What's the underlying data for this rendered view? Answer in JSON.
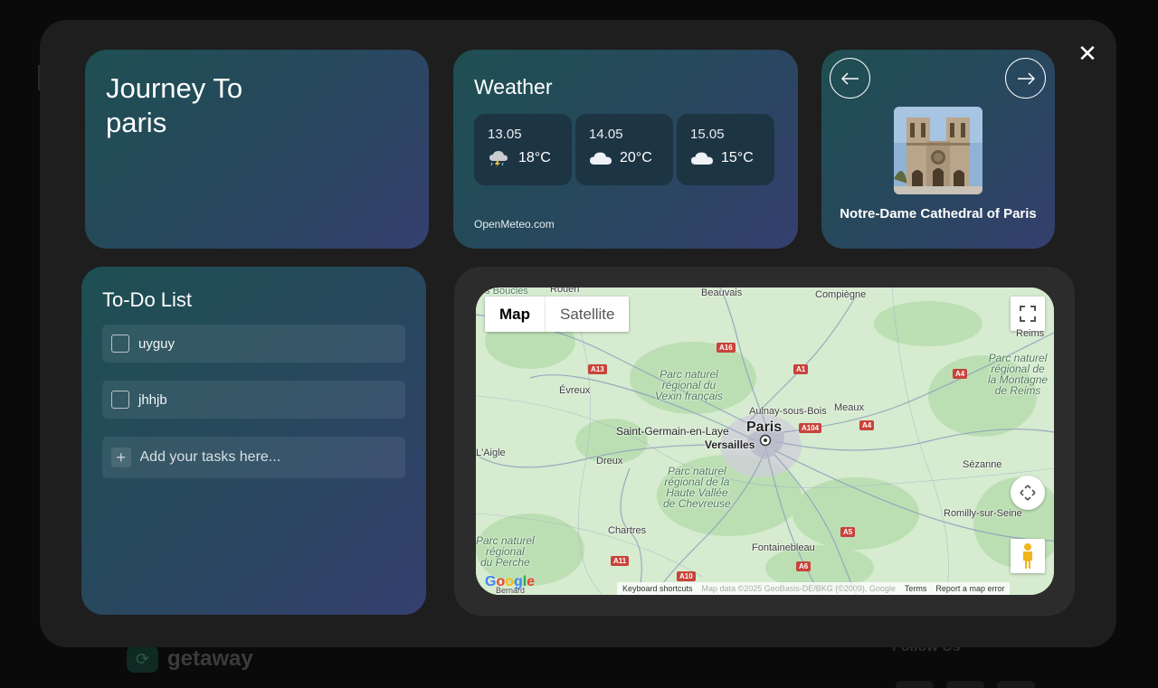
{
  "background": {
    "brand": "getaway",
    "follow_label": "Follow Us"
  },
  "trip": {
    "title_line1": "Journey To",
    "title_line2": "paris"
  },
  "weather": {
    "title": "Weather",
    "source": "OpenMeteo.com",
    "days": [
      {
        "date": "13.05",
        "temp": "18°C",
        "icon": "thunderstorm-icon"
      },
      {
        "date": "14.05",
        "temp": "20°C",
        "icon": "cloud-icon"
      },
      {
        "date": "15.05",
        "temp": "15°C",
        "icon": "cloud-icon"
      }
    ]
  },
  "place": {
    "name": "Notre-Dame Cathedral of Paris"
  },
  "todo": {
    "title": "To-Do List",
    "tasks": [
      {
        "label": "uyguy"
      },
      {
        "label": "jhhjb"
      }
    ],
    "add_placeholder": "Add your tasks here..."
  },
  "map": {
    "type_map": "Map",
    "type_satellite": "Satellite",
    "google": "Google",
    "footer": {
      "shortcuts": "Keyboard shortcuts",
      "data": "Map data ©2025 GeoBasis-DE/BKG (©2009), Google",
      "terms": "Terms",
      "report": "Report a map error"
    },
    "places": {
      "paris": "Paris",
      "versailles": "Versailles",
      "aulnay": "Aulnay-sous-Bois",
      "saint_germain": "Saint-Germain-en-Laye",
      "meaux": "Meaux",
      "evreux": "Évreux",
      "beauvais": "Beauvais",
      "compiegne": "Compiègne",
      "reims": "Reims",
      "rouen": "Rouen",
      "laigle": "L'Aigle",
      "dreux": "Dreux",
      "chartres": "Chartres",
      "fontainebleau": "Fontainebleau",
      "sezanne": "Sézanne",
      "romilly": "Romilly-sur-Seine",
      "bernard": "Bernard",
      "boucles": "es Boucles"
    },
    "parks": {
      "vexin": "Parc naturel\nrégional du\nVexin français",
      "chevreuse": "Parc naturel\nrégional de la\nHaute Vallée\nde Chevreuse",
      "reims_mountain": "Parc naturel\nrégional de\nla Montagne\nde Reims",
      "perche": "Parc naturel\nrégional\ndu Perche"
    },
    "roads": [
      "A16",
      "A1",
      "A13",
      "A4",
      "A104",
      "A4",
      "A10",
      "A11",
      "A5",
      "A6",
      "A4"
    ]
  }
}
